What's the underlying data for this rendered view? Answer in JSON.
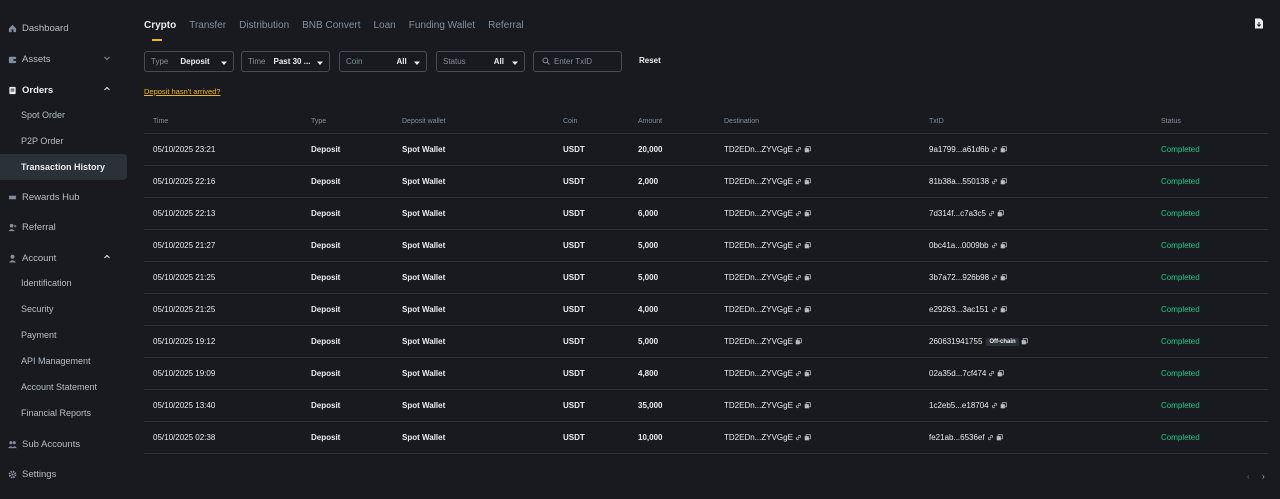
{
  "sidebar": {
    "dashboard": "Dashboard",
    "assets": "Assets",
    "orders": "Orders",
    "orders_items": [
      "Spot Order",
      "P2P Order",
      "Transaction History"
    ],
    "rewards": "Rewards Hub",
    "referral": "Referral",
    "account": "Account",
    "account_items": [
      "Identification",
      "Security",
      "Payment",
      "API Management",
      "Account Statement",
      "Financial Reports"
    ],
    "sub_accounts": "Sub Accounts",
    "settings": "Settings"
  },
  "tabs": [
    "Crypto",
    "Transfer",
    "Distribution",
    "BNB Convert",
    "Loan",
    "Funding Wallet",
    "Referral"
  ],
  "filters": {
    "type_label": "Type",
    "type_value": "Deposit",
    "time_label": "Time",
    "time_value": "Past 30 ...",
    "coin_label": "Coin",
    "coin_value": "All",
    "status_label": "Status",
    "status_value": "All",
    "txid_placeholder": "Enter TxID",
    "reset": "Reset"
  },
  "deposit_link": "Deposit hasn't arrived?",
  "table": {
    "headers": [
      "Time",
      "Type",
      "Deposit wallet",
      "Coin",
      "Amount",
      "Destination",
      "TxID",
      "Status"
    ],
    "rows": [
      {
        "time": "05/10/2025 23:21",
        "type": "Deposit",
        "wallet": "Spot Wallet",
        "coin": "USDT",
        "amount": "20,000",
        "dest": "TD2EDn...ZYVGgE",
        "txid": "9a1799...a61d6b",
        "tag": "",
        "status": "Completed"
      },
      {
        "time": "05/10/2025 22:16",
        "type": "Deposit",
        "wallet": "Spot Wallet",
        "coin": "USDT",
        "amount": "2,000",
        "dest": "TD2EDn...ZYVGgE",
        "txid": "81b38a...550138",
        "tag": "",
        "status": "Completed"
      },
      {
        "time": "05/10/2025 22:13",
        "type": "Deposit",
        "wallet": "Spot Wallet",
        "coin": "USDT",
        "amount": "6,000",
        "dest": "TD2EDn...ZYVGgE",
        "txid": "7d314f...c7a3c5",
        "tag": "",
        "status": "Completed"
      },
      {
        "time": "05/10/2025 21:27",
        "type": "Deposit",
        "wallet": "Spot Wallet",
        "coin": "USDT",
        "amount": "5,000",
        "dest": "TD2EDn...ZYVGgE",
        "txid": "0bc41a...0009bb",
        "tag": "",
        "status": "Completed"
      },
      {
        "time": "05/10/2025 21:25",
        "type": "Deposit",
        "wallet": "Spot Wallet",
        "coin": "USDT",
        "amount": "5,000",
        "dest": "TD2EDn...ZYVGgE",
        "txid": "3b7a72...926b98",
        "tag": "",
        "status": "Completed"
      },
      {
        "time": "05/10/2025 21:25",
        "type": "Deposit",
        "wallet": "Spot Wallet",
        "coin": "USDT",
        "amount": "4,000",
        "dest": "TD2EDn...ZYVGgE",
        "txid": "e29263...3ac151",
        "tag": "",
        "status": "Completed"
      },
      {
        "time": "05/10/2025 19:12",
        "type": "Deposit",
        "wallet": "Spot Wallet",
        "coin": "USDT",
        "amount": "5,000",
        "dest": "TD2EDn...ZYVGgE",
        "txid": "260631941755",
        "tag": "Off-chain",
        "status": "Completed"
      },
      {
        "time": "05/10/2025 19:09",
        "type": "Deposit",
        "wallet": "Spot Wallet",
        "coin": "USDT",
        "amount": "4,800",
        "dest": "TD2EDn...ZYVGgE",
        "txid": "02a35d...7cf474",
        "tag": "",
        "status": "Completed"
      },
      {
        "time": "05/10/2025 13:40",
        "type": "Deposit",
        "wallet": "Spot Wallet",
        "coin": "USDT",
        "amount": "35,000",
        "dest": "TD2EDn...ZYVGgE",
        "txid": "1c2eb5...e18704",
        "tag": "",
        "status": "Completed"
      },
      {
        "time": "05/10/2025 02:38",
        "type": "Deposit",
        "wallet": "Spot Wallet",
        "coin": "USDT",
        "amount": "10,000",
        "dest": "TD2EDn...ZYVGgE",
        "txid": "fe21ab...6536ef",
        "tag": "",
        "status": "Completed"
      }
    ]
  },
  "pager": {
    "prev": "‹",
    "next": "›"
  },
  "colors": {
    "accent": "#f0b90b",
    "success": "#0ecb81",
    "bg": "#181a20"
  }
}
